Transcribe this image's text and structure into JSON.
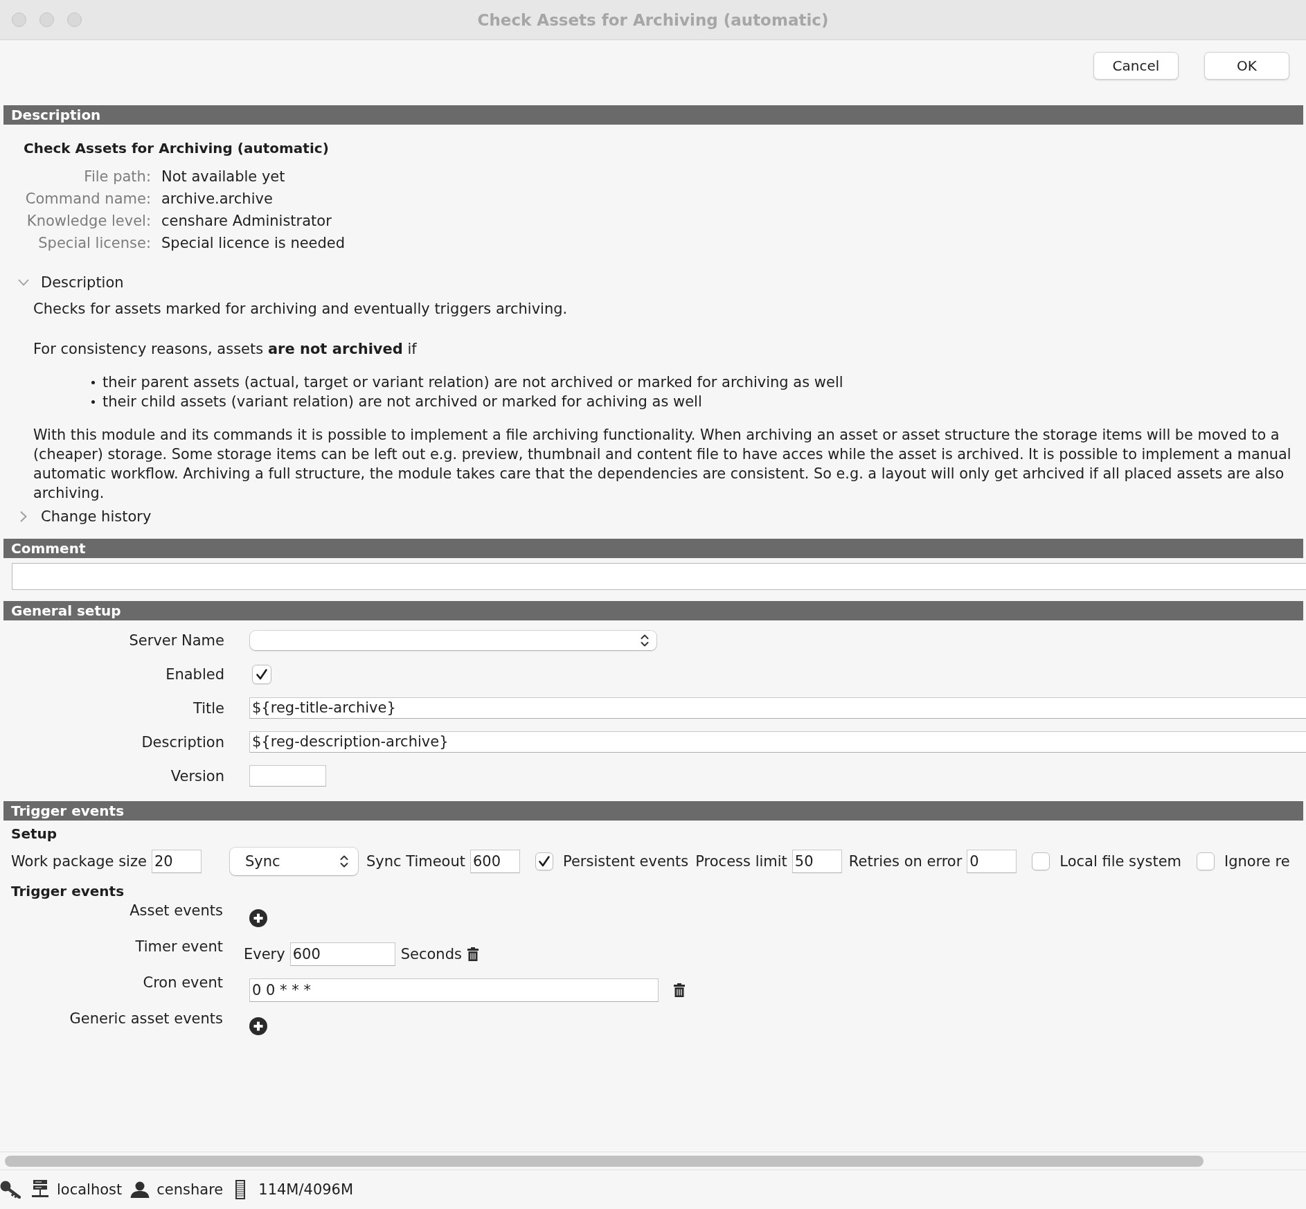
{
  "window": {
    "title": "Check Assets for Archiving (automatic)"
  },
  "buttons": [
    {
      "label": "Cancel"
    },
    {
      "label": "OK"
    }
  ],
  "description": {
    "header": "Description",
    "heading": "Check Assets for Archiving (automatic)",
    "info": [
      {
        "label": "File path:",
        "value": "Not available yet"
      },
      {
        "label": "Command name:",
        "value": "archive.archive"
      },
      {
        "label": "Knowledge level:",
        "value": "censhare Administrator"
      },
      {
        "label": "Special license:",
        "value": "Special licence is needed"
      }
    ],
    "details": {
      "label": "Description",
      "expanded": true,
      "summary": "Checks for assets marked for archiving and eventually triggers archiving.",
      "condition": "For consistency reasons, assets **are not archived** if",
      "bullets": [
        "their parent assets (actual, target or variant relation) are not archived or marked for archiving as well",
        "their child assets (variant relation) are not archived or marked for achiving as well"
      ],
      "text_lines": [
        "With this module and its commands it is possible to implement a file archiving functionality. When archiving an asset or asset structure the storage items will be moved to a",
        "(cheaper) storage. Some storage items can be left out e.g. preview, thumbnail and content file to have acces while the asset is archived. It is possible to implement a manual",
        "automatic workflow. Archiving a full structure, the module takes care that the dependencies are consistent. So e.g. a layout will only get arhcived if all placed assets are also",
        "archiving."
      ]
    },
    "change_history": {
      "label": "Change history",
      "expanded": false
    }
  },
  "comment": {
    "header": "Comment"
  },
  "general_setup": {
    "header": "General setup",
    "fields": [
      {
        "kind": "select",
        "label": "Server Name"
      },
      {
        "kind": "checkbox",
        "label": "Enabled",
        "checked": true
      },
      {
        "kind": "text",
        "label": "Title",
        "value": "${reg-title-archive}"
      },
      {
        "kind": "text",
        "label": "Description",
        "value": "${reg-description-archive}"
      },
      {
        "kind": "short_text",
        "label": "Version"
      }
    ]
  },
  "trigger_events": {
    "header": "Trigger events",
    "setup": {
      "title": "Setup",
      "items": [
        {
          "kind": "field",
          "label": "Work package size",
          "value": "20"
        },
        {
          "kind": "select",
          "value": "Sync"
        },
        {
          "kind": "field",
          "label": "Sync Timeout",
          "value": "600"
        },
        {
          "kind": "checkbox",
          "label": "Persistent events",
          "checked": true
        },
        {
          "kind": "field",
          "label": "Process limit",
          "value": "50"
        },
        {
          "kind": "field",
          "label": "Retries on error",
          "value": "0"
        },
        {
          "kind": "checkbox",
          "label": "Local file system",
          "checked": false
        },
        {
          "kind": "checkbox",
          "label": "Ignore re",
          "checked": false
        }
      ]
    },
    "events": {
      "title": "Trigger events",
      "items": [
        {
          "kind": "add",
          "label": "Asset events"
        },
        {
          "kind": "timer",
          "label": "Timer event",
          "prefix": "Every",
          "value": "600",
          "unit": "Seconds"
        },
        {
          "kind": "cron",
          "label": "Cron event",
          "value": "0 0 * * *"
        },
        {
          "kind": "add",
          "label": "Generic asset events"
        }
      ]
    }
  },
  "status_bar": {
    "server": "localhost",
    "user": "censhare",
    "memory": "114M/4096M"
  }
}
